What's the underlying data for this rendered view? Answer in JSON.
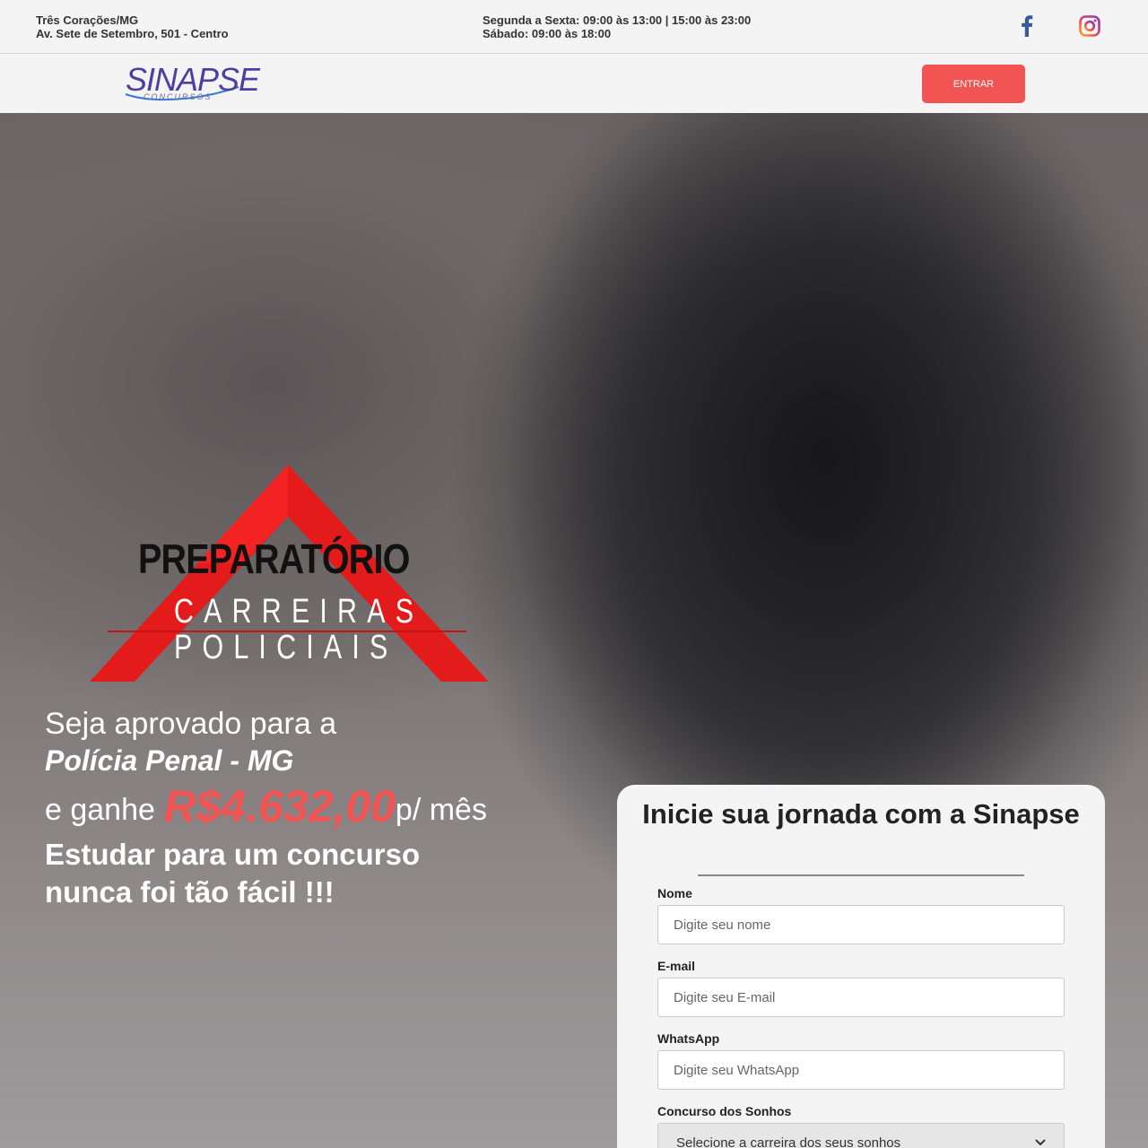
{
  "topbar": {
    "city": "Três Corações/MG",
    "address": "Av. Sete de Setembro, 501 - Centro",
    "hours_week": "Segunda a Sexta: 09:00 às 13:00 | 15:00 às 23:00",
    "hours_saturday": "Sábado: 09:00 às 18:00",
    "social_icons": [
      "facebook-icon",
      "instagram-icon"
    ],
    "facebook_color": "#3b5998"
  },
  "nav": {
    "logo_text": "SINAPSE",
    "logo_sub": "CONCURSOS",
    "login_label": "ENTRAR",
    "accent": "#f25454"
  },
  "hero": {
    "emblem_prep": "PREPARATÓRIO",
    "emblem_line1": "CARREIRAS",
    "emblem_line2": "POLICIAIS",
    "headline_1": "Seja aprovado para a",
    "headline_2": "Polícia Penal - MG",
    "headline_3_pre": "e ganhe ",
    "salary": "R$4.632,00",
    "headline_3_post": "p/ mês",
    "headline_4": "Estudar para um concurso nunca foi tão fácil !!!"
  },
  "form": {
    "title": "Inicie sua jornada com a Sinapse",
    "name_label": "Nome",
    "name_placeholder": "Digite seu nome",
    "email_label": "E-mail",
    "email_placeholder": "Digite seu E-mail",
    "whatsapp_label": "WhatsApp",
    "whatsapp_placeholder": "Digite seu WhatsApp",
    "career_label": "Concurso dos Sonhos",
    "career_selected": "Selecione a carreira dos seus sonhos"
  }
}
